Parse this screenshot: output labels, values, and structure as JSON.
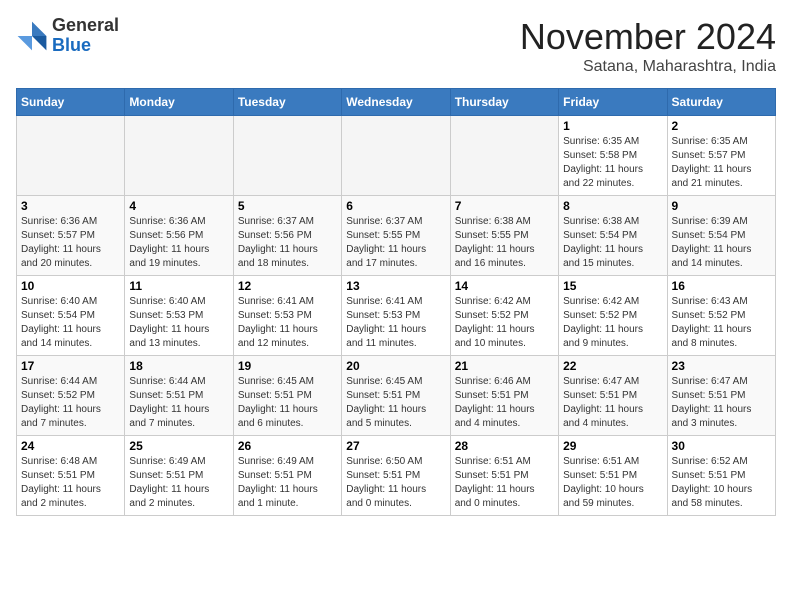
{
  "header": {
    "logo_line1": "General",
    "logo_line2": "Blue",
    "month": "November 2024",
    "location": "Satana, Maharashtra, India"
  },
  "calendar": {
    "headers": [
      "Sunday",
      "Monday",
      "Tuesday",
      "Wednesday",
      "Thursday",
      "Friday",
      "Saturday"
    ],
    "weeks": [
      [
        {
          "day": "",
          "info": ""
        },
        {
          "day": "",
          "info": ""
        },
        {
          "day": "",
          "info": ""
        },
        {
          "day": "",
          "info": ""
        },
        {
          "day": "",
          "info": ""
        },
        {
          "day": "1",
          "info": "Sunrise: 6:35 AM\nSunset: 5:58 PM\nDaylight: 11 hours\nand 22 minutes."
        },
        {
          "day": "2",
          "info": "Sunrise: 6:35 AM\nSunset: 5:57 PM\nDaylight: 11 hours\nand 21 minutes."
        }
      ],
      [
        {
          "day": "3",
          "info": "Sunrise: 6:36 AM\nSunset: 5:57 PM\nDaylight: 11 hours\nand 20 minutes."
        },
        {
          "day": "4",
          "info": "Sunrise: 6:36 AM\nSunset: 5:56 PM\nDaylight: 11 hours\nand 19 minutes."
        },
        {
          "day": "5",
          "info": "Sunrise: 6:37 AM\nSunset: 5:56 PM\nDaylight: 11 hours\nand 18 minutes."
        },
        {
          "day": "6",
          "info": "Sunrise: 6:37 AM\nSunset: 5:55 PM\nDaylight: 11 hours\nand 17 minutes."
        },
        {
          "day": "7",
          "info": "Sunrise: 6:38 AM\nSunset: 5:55 PM\nDaylight: 11 hours\nand 16 minutes."
        },
        {
          "day": "8",
          "info": "Sunrise: 6:38 AM\nSunset: 5:54 PM\nDaylight: 11 hours\nand 15 minutes."
        },
        {
          "day": "9",
          "info": "Sunrise: 6:39 AM\nSunset: 5:54 PM\nDaylight: 11 hours\nand 14 minutes."
        }
      ],
      [
        {
          "day": "10",
          "info": "Sunrise: 6:40 AM\nSunset: 5:54 PM\nDaylight: 11 hours\nand 14 minutes."
        },
        {
          "day": "11",
          "info": "Sunrise: 6:40 AM\nSunset: 5:53 PM\nDaylight: 11 hours\nand 13 minutes."
        },
        {
          "day": "12",
          "info": "Sunrise: 6:41 AM\nSunset: 5:53 PM\nDaylight: 11 hours\nand 12 minutes."
        },
        {
          "day": "13",
          "info": "Sunrise: 6:41 AM\nSunset: 5:53 PM\nDaylight: 11 hours\nand 11 minutes."
        },
        {
          "day": "14",
          "info": "Sunrise: 6:42 AM\nSunset: 5:52 PM\nDaylight: 11 hours\nand 10 minutes."
        },
        {
          "day": "15",
          "info": "Sunrise: 6:42 AM\nSunset: 5:52 PM\nDaylight: 11 hours\nand 9 minutes."
        },
        {
          "day": "16",
          "info": "Sunrise: 6:43 AM\nSunset: 5:52 PM\nDaylight: 11 hours\nand 8 minutes."
        }
      ],
      [
        {
          "day": "17",
          "info": "Sunrise: 6:44 AM\nSunset: 5:52 PM\nDaylight: 11 hours\nand 7 minutes."
        },
        {
          "day": "18",
          "info": "Sunrise: 6:44 AM\nSunset: 5:51 PM\nDaylight: 11 hours\nand 7 minutes."
        },
        {
          "day": "19",
          "info": "Sunrise: 6:45 AM\nSunset: 5:51 PM\nDaylight: 11 hours\nand 6 minutes."
        },
        {
          "day": "20",
          "info": "Sunrise: 6:45 AM\nSunset: 5:51 PM\nDaylight: 11 hours\nand 5 minutes."
        },
        {
          "day": "21",
          "info": "Sunrise: 6:46 AM\nSunset: 5:51 PM\nDaylight: 11 hours\nand 4 minutes."
        },
        {
          "day": "22",
          "info": "Sunrise: 6:47 AM\nSunset: 5:51 PM\nDaylight: 11 hours\nand 4 minutes."
        },
        {
          "day": "23",
          "info": "Sunrise: 6:47 AM\nSunset: 5:51 PM\nDaylight: 11 hours\nand 3 minutes."
        }
      ],
      [
        {
          "day": "24",
          "info": "Sunrise: 6:48 AM\nSunset: 5:51 PM\nDaylight: 11 hours\nand 2 minutes."
        },
        {
          "day": "25",
          "info": "Sunrise: 6:49 AM\nSunset: 5:51 PM\nDaylight: 11 hours\nand 2 minutes."
        },
        {
          "day": "26",
          "info": "Sunrise: 6:49 AM\nSunset: 5:51 PM\nDaylight: 11 hours\nand 1 minute."
        },
        {
          "day": "27",
          "info": "Sunrise: 6:50 AM\nSunset: 5:51 PM\nDaylight: 11 hours\nand 0 minutes."
        },
        {
          "day": "28",
          "info": "Sunrise: 6:51 AM\nSunset: 5:51 PM\nDaylight: 11 hours\nand 0 minutes."
        },
        {
          "day": "29",
          "info": "Sunrise: 6:51 AM\nSunset: 5:51 PM\nDaylight: 10 hours\nand 59 minutes."
        },
        {
          "day": "30",
          "info": "Sunrise: 6:52 AM\nSunset: 5:51 PM\nDaylight: 10 hours\nand 58 minutes."
        }
      ]
    ]
  }
}
